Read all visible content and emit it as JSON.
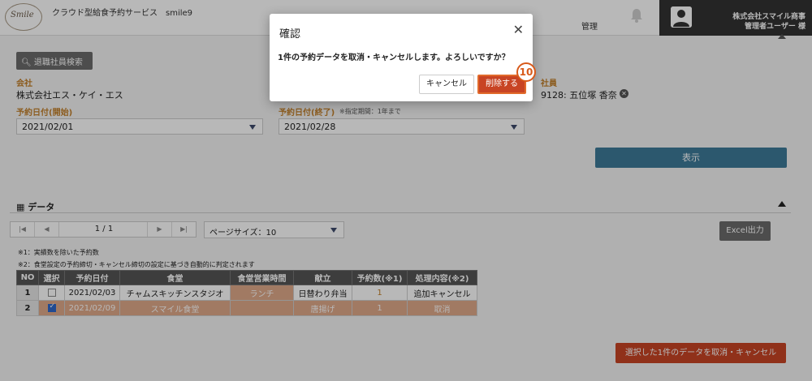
{
  "header": {
    "logo_text": "Smile",
    "app_title": "クラウド型給食予約サービス　smile9",
    "nav_admin": "管理",
    "user_company": "株式会社スマイル商事",
    "user_role": "管理者ユーザー 様"
  },
  "search": {
    "retired_search_label": "退職社員検索",
    "company_label": "会社",
    "company_value": "株式会社エス・ケイ・エス",
    "employee_label": "社員",
    "employee_value": "9128:  五位塚 香奈",
    "date_from_label": "予約日付(開始)",
    "date_from_value": "2021/02/01",
    "date_to_label": "予約日付(終了)",
    "date_to_note": "※指定期間：1年まで",
    "date_to_value": "2021/02/28",
    "show_label": "表示"
  },
  "data_section": {
    "title": "データ",
    "pager_text": "1 / 1",
    "page_size": "ページサイズ：10",
    "excel_label": "Excel出力",
    "footnote1": "※1：実績数を除いた予約数",
    "footnote2": "※2：食堂設定の予約締切・キャンセル締切の設定に基づき自動的に判定されます",
    "columns": [
      "NO",
      "選択",
      "予約日付",
      "食堂",
      "食堂営業時間",
      "献立",
      "予約数(※1)",
      "処理内容(※2)"
    ],
    "rows": [
      {
        "no": "1",
        "checked": false,
        "date": "2021/02/03",
        "cafeteria": "チャムスキッチンスタジオ",
        "hours": "ランチ",
        "menu": "日替わり弁当",
        "count": "1",
        "action": "追加キャンセル"
      },
      {
        "no": "2",
        "checked": true,
        "date": "2021/02/09",
        "cafeteria": "スマイル食堂",
        "hours": "",
        "menu": "唐揚げ",
        "count": "1",
        "action": "取消"
      }
    ],
    "bulk_cancel_label": "選択した1件のデータを取消・キャンセル"
  },
  "modal": {
    "title": "確認",
    "message": "1件の予約データを取消・キャンセルします。よろしいですか？",
    "cancel_label": "キャンセル",
    "delete_label": "削除する",
    "callout": "10"
  }
}
